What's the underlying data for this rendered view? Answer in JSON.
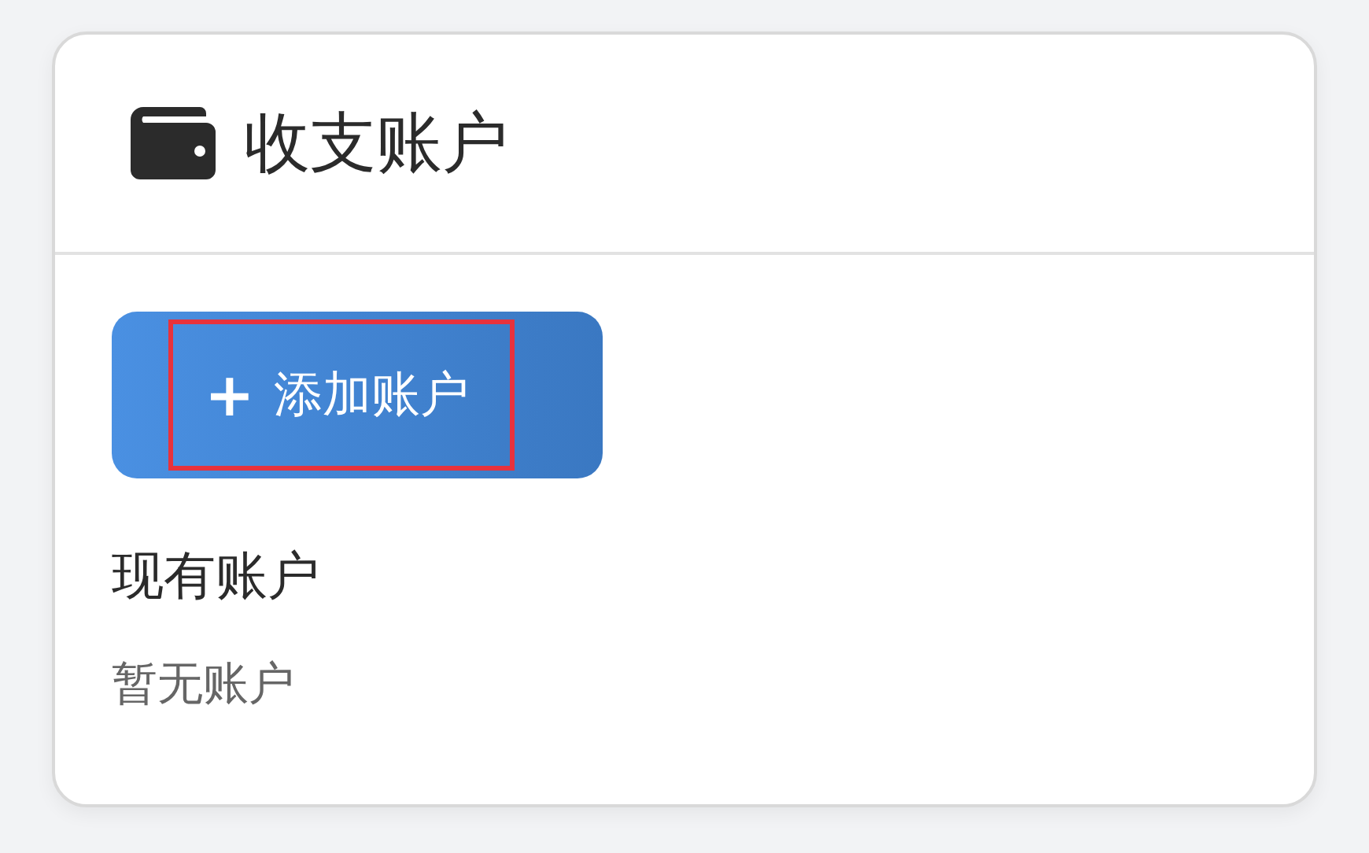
{
  "card": {
    "title": "收支账户"
  },
  "add_button": {
    "icon": "+",
    "label": "添加账户",
    "highlighted": true
  },
  "section": {
    "heading": "现有账户",
    "empty_text": "暂无账户"
  }
}
